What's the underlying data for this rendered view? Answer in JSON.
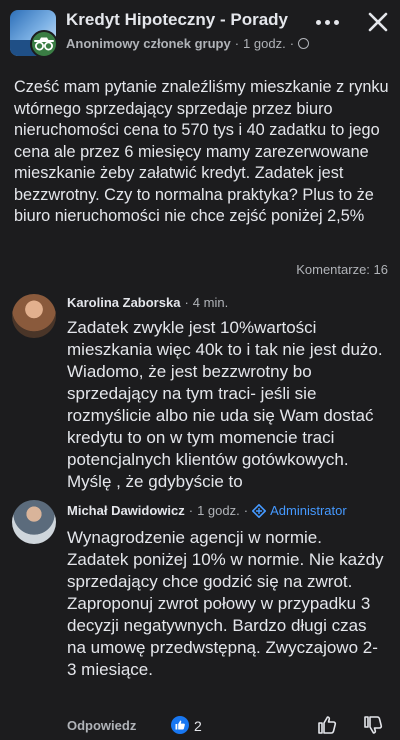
{
  "post": {
    "group_name": "Kredyt Hipoteczny - Porady",
    "author": "Anonimowy członek grupy",
    "separator": "·",
    "time": "1 godz.",
    "text": "Cześć mam pytanie znaleźliśmy mieszkanie z rynku wtórnego sprzedający sprzedaje przez biuro nieruchomości cena to 570 tys i 40 zadatku to jego cena ale przez 6 miesięcy mamy zarezerwowane mieszkanie żeby załatwić kredyt. Zadatek jest bezzwrotny. Czy to normalna praktyka? Plus to że biuro nieruchomości nie chce zejść poniżej 2,5%",
    "comments_label": "Komentarze: 16"
  },
  "comments": [
    {
      "name": "Karolina Zaborska",
      "separator": "·",
      "time": "4 min.",
      "text": "Zadatek zwykle jest 10%wartości mieszkania więc 40k to i tak nie jest dużo. Wiadomo, że jest bezzwrotny bo sprzedający na tym traci- jeśli sie rozmyślicie albo nie uda się Wam dostać kredytu to on w tym momencie traci potencjalnych klientów gotówkowych.  Myślę , że gdybyście to"
    },
    {
      "name": "Michał Dawidowicz",
      "separator": "·",
      "time": "1 godz.",
      "separator2": "·",
      "badge": "Administrator",
      "text": "Wynagrodzenie agencji w normie. Zadatek poniżej 10% w normie. Nie każdy sprzedający chce godzić się na zwrot. Zaproponuj zwrot połowy w przypadku 3 decyzji negatywnych. Bardzo długi czas na umowę przedwstępną. Zwyczajowo 2-3 miesiące."
    }
  ],
  "actions": {
    "reply_label": "Odpowiedz",
    "like_count": "2"
  },
  "icons": {
    "more": "more-dots-icon",
    "close": "close-icon",
    "privacy": "globe-icon",
    "admin": "admin-shield-icon",
    "like": "like-thumb-icon",
    "dislike": "thumb-down-icon"
  },
  "colors": {
    "background": "#1c1c1e",
    "text": "#e4e6eb",
    "muted": "#b0b3b8",
    "accent": "#4599ff",
    "like": "#1877f2"
  }
}
